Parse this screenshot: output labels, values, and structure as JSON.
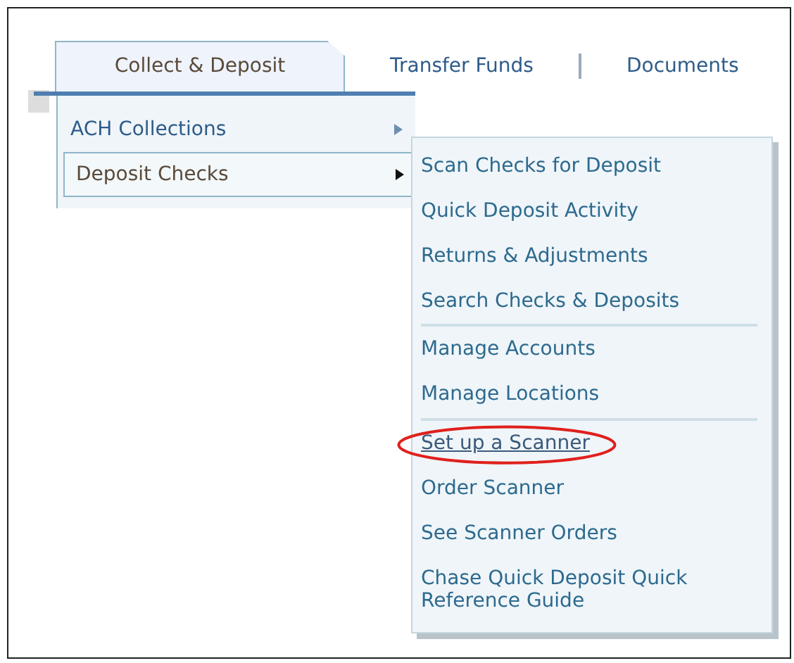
{
  "tabs": [
    {
      "label": "Collect & Deposit",
      "selected": true
    },
    {
      "label": "Transfer Funds",
      "selected": false
    },
    {
      "label": "Documents",
      "selected": false
    }
  ],
  "menu": {
    "items": [
      {
        "label": "ACH Collections",
        "selected": false
      },
      {
        "label": "Deposit Checks",
        "selected": true
      }
    ]
  },
  "submenu": {
    "groups": [
      {
        "items": [
          {
            "label": "Scan Checks for Deposit",
            "hovered": false,
            "circled": false
          },
          {
            "label": "Quick Deposit Activity",
            "hovered": false,
            "circled": false
          },
          {
            "label": "Returns & Adjustments",
            "hovered": false,
            "circled": false
          },
          {
            "label": "Search Checks & Deposits",
            "hovered": false,
            "circled": false
          }
        ]
      },
      {
        "items": [
          {
            "label": "Manage Accounts",
            "hovered": false,
            "circled": false
          },
          {
            "label": "Manage Locations",
            "hovered": false,
            "circled": false
          }
        ]
      },
      {
        "items": [
          {
            "label": "Set up a Scanner",
            "hovered": true,
            "circled": true
          },
          {
            "label": "Order Scanner",
            "hovered": false,
            "circled": false
          },
          {
            "label": "See Scanner Orders",
            "hovered": false,
            "circled": false
          },
          {
            "label": "Chase Quick Deposit Quick Reference Guide",
            "hovered": false,
            "circled": false
          }
        ]
      }
    ]
  }
}
